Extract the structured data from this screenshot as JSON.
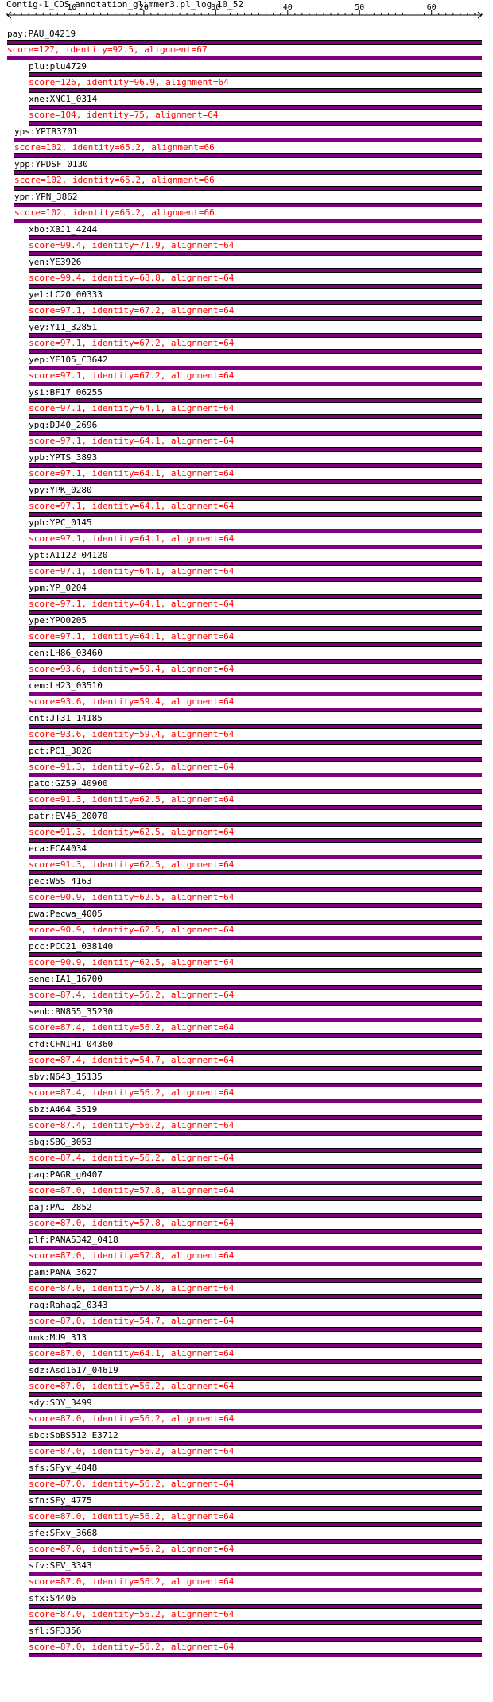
{
  "track_title": "Contig-1_CDS_annotation_glimmer3.pl_log_10_52",
  "ruler": {
    "tick_labels": [
      "10",
      "20",
      "30",
      "40",
      "50",
      "60"
    ],
    "bp_start": 1,
    "bp_end": 67
  },
  "colors": {
    "bar": "#800080",
    "bar_edge": "#000000",
    "score_text": "#ff0000",
    "name_text": "#000000"
  },
  "hits": [
    {
      "name": "pay:PAU_04219",
      "score": "score=127, identity=92.5, alignment=67",
      "start": 1,
      "end": 67
    },
    {
      "name": "plu:plu4729",
      "score": "score=126, identity=96.9, alignment=64",
      "start": 4,
      "end": 67
    },
    {
      "name": "xne:XNC1_0314",
      "score": "score=104, identity=75, alignment=64",
      "start": 4,
      "end": 67
    },
    {
      "name": "yps:YPTB3701",
      "score": "score=102, identity=65.2, alignment=66",
      "start": 2,
      "end": 67
    },
    {
      "name": "ypp:YPDSF_0130",
      "score": "score=102, identity=65.2, alignment=66",
      "start": 2,
      "end": 67
    },
    {
      "name": "ypn:YPN_3862",
      "score": "score=102, identity=65.2, alignment=66",
      "start": 2,
      "end": 67
    },
    {
      "name": "xbo:XBJ1_4244",
      "score": "score=99.4, identity=71.9, alignment=64",
      "start": 4,
      "end": 67
    },
    {
      "name": "yen:YE3926",
      "score": "score=99.4, identity=68.8, alignment=64",
      "start": 4,
      "end": 67
    },
    {
      "name": "yel:LC20_00333",
      "score": "score=97.1, identity=67.2, alignment=64",
      "start": 4,
      "end": 67
    },
    {
      "name": "yey:Y11_32851",
      "score": "score=97.1, identity=67.2, alignment=64",
      "start": 4,
      "end": 67
    },
    {
      "name": "yep:YE105_C3642",
      "score": "score=97.1, identity=67.2, alignment=64",
      "start": 4,
      "end": 67
    },
    {
      "name": "ysi:BF17_06255",
      "score": "score=97.1, identity=64.1, alignment=64",
      "start": 4,
      "end": 67
    },
    {
      "name": "ypq:DJ40_2696",
      "score": "score=97.1, identity=64.1, alignment=64",
      "start": 4,
      "end": 67
    },
    {
      "name": "ypb:YPTS_3893",
      "score": "score=97.1, identity=64.1, alignment=64",
      "start": 4,
      "end": 67
    },
    {
      "name": "ypy:YPK_0280",
      "score": "score=97.1, identity=64.1, alignment=64",
      "start": 4,
      "end": 67
    },
    {
      "name": "yph:YPC_0145",
      "score": "score=97.1, identity=64.1, alignment=64",
      "start": 4,
      "end": 67
    },
    {
      "name": "ypt:A1122_04120",
      "score": "score=97.1, identity=64.1, alignment=64",
      "start": 4,
      "end": 67
    },
    {
      "name": "ypm:YP_0204",
      "score": "score=97.1, identity=64.1, alignment=64",
      "start": 4,
      "end": 67
    },
    {
      "name": "ype:YPO0205",
      "score": "score=97.1, identity=64.1, alignment=64",
      "start": 4,
      "end": 67
    },
    {
      "name": "cen:LH86_03460",
      "score": "score=93.6, identity=59.4, alignment=64",
      "start": 4,
      "end": 67
    },
    {
      "name": "cem:LH23_03510",
      "score": "score=93.6, identity=59.4, alignment=64",
      "start": 4,
      "end": 67
    },
    {
      "name": "cnt:JT31_14185",
      "score": "score=93.6, identity=59.4, alignment=64",
      "start": 4,
      "end": 67
    },
    {
      "name": "pct:PC1_3826",
      "score": "score=91.3, identity=62.5, alignment=64",
      "start": 4,
      "end": 67
    },
    {
      "name": "pato:GZ59_40900",
      "score": "score=91.3, identity=62.5, alignment=64",
      "start": 4,
      "end": 67
    },
    {
      "name": "patr:EV46_20070",
      "score": "score=91.3, identity=62.5, alignment=64",
      "start": 4,
      "end": 67
    },
    {
      "name": "eca:ECA4034",
      "score": "score=91.3, identity=62.5, alignment=64",
      "start": 4,
      "end": 67
    },
    {
      "name": "pec:W5S_4163",
      "score": "score=90.9, identity=62.5, alignment=64",
      "start": 4,
      "end": 67
    },
    {
      "name": "pwa:Pecwa_4005",
      "score": "score=90.9, identity=62.5, alignment=64",
      "start": 4,
      "end": 67
    },
    {
      "name": "pcc:PCC21_038140",
      "score": "score=90.9, identity=62.5, alignment=64",
      "start": 4,
      "end": 67
    },
    {
      "name": "sene:IA1_16700",
      "score": "score=87.4, identity=56.2, alignment=64",
      "start": 4,
      "end": 67
    },
    {
      "name": "senb:BN855_35230",
      "score": "score=87.4, identity=56.2, alignment=64",
      "start": 4,
      "end": 67
    },
    {
      "name": "cfd:CFNIH1_04360",
      "score": "score=87.4, identity=54.7, alignment=64",
      "start": 4,
      "end": 67
    },
    {
      "name": "sbv:N643_15135",
      "score": "score=87.4, identity=56.2, alignment=64",
      "start": 4,
      "end": 67
    },
    {
      "name": "sbz:A464_3519",
      "score": "score=87.4, identity=56.2, alignment=64",
      "start": 4,
      "end": 67
    },
    {
      "name": "sbg:SBG_3053",
      "score": "score=87.4, identity=56.2, alignment=64",
      "start": 4,
      "end": 67
    },
    {
      "name": "paq:PAGR_g0407",
      "score": "score=87.0, identity=57.8, alignment=64",
      "start": 4,
      "end": 67
    },
    {
      "name": "paj:PAJ_2852",
      "score": "score=87.0, identity=57.8, alignment=64",
      "start": 4,
      "end": 67
    },
    {
      "name": "plf:PANA5342_0418",
      "score": "score=87.0, identity=57.8, alignment=64",
      "start": 4,
      "end": 67
    },
    {
      "name": "pam:PANA_3627",
      "score": "score=87.0, identity=57.8, alignment=64",
      "start": 4,
      "end": 67
    },
    {
      "name": "raq:Rahaq2_0343",
      "score": "score=87.0, identity=54.7, alignment=64",
      "start": 4,
      "end": 67
    },
    {
      "name": "mmk:MU9_313",
      "score": "score=87.0, identity=64.1, alignment=64",
      "start": 4,
      "end": 67
    },
    {
      "name": "sdz:Asd1617_04619",
      "score": "score=87.0, identity=56.2, alignment=64",
      "start": 4,
      "end": 67
    },
    {
      "name": "sdy:SDY_3499",
      "score": "score=87.0, identity=56.2, alignment=64",
      "start": 4,
      "end": 67
    },
    {
      "name": "sbc:SbBS512_E3712",
      "score": "score=87.0, identity=56.2, alignment=64",
      "start": 4,
      "end": 67
    },
    {
      "name": "sfs:SFyv_4848",
      "score": "score=87.0, identity=56.2, alignment=64",
      "start": 4,
      "end": 67
    },
    {
      "name": "sfn:SFy_4775",
      "score": "score=87.0, identity=56.2, alignment=64",
      "start": 4,
      "end": 67
    },
    {
      "name": "sfe:SFxv_3668",
      "score": "score=87.0, identity=56.2, alignment=64",
      "start": 4,
      "end": 67
    },
    {
      "name": "sfv:SFV_3343",
      "score": "score=87.0, identity=56.2, alignment=64",
      "start": 4,
      "end": 67
    },
    {
      "name": "sfx:S4406",
      "score": "score=87.0, identity=56.2, alignment=64",
      "start": 4,
      "end": 67
    },
    {
      "name": "sfl:SF3356",
      "score": "score=87.0, identity=56.2, alignment=64",
      "start": 4,
      "end": 67
    }
  ]
}
